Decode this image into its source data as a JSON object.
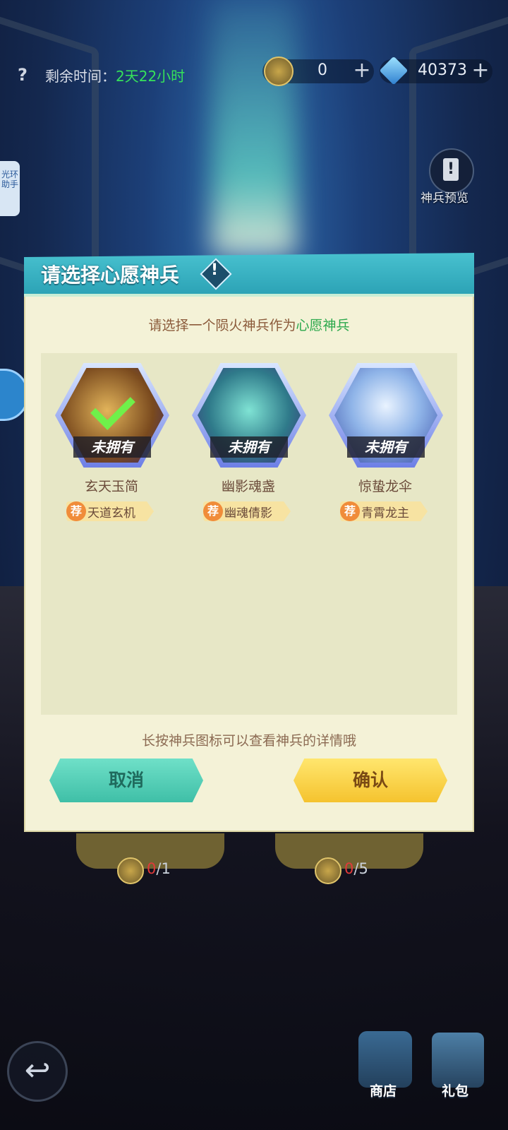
{
  "topbar": {
    "help": "?",
    "time_label": "剩余时间：",
    "time_value": "2天22小时",
    "currency_a": "0",
    "currency_b": "40373",
    "plus": "+"
  },
  "side": {
    "tab_label": "光环助手"
  },
  "preview": {
    "label": "神兵预览",
    "icon_glyph": "!"
  },
  "dialog": {
    "title": "请选择心愿神兵",
    "info_glyph": "!",
    "subtitle_pre": "请选择一个陨火神兵作为",
    "subtitle_hl": "心愿神兵",
    "items": [
      {
        "name": "玄天玉简",
        "status": "未拥有",
        "tag_icon": "荐",
        "tag": "天道玄机",
        "selected": true,
        "color": "#c98a3a"
      },
      {
        "name": "幽影魂盏",
        "status": "未拥有",
        "tag_icon": "荐",
        "tag": "幽魂倩影",
        "selected": false,
        "color": "#3aa7a0"
      },
      {
        "name": "惊蛰龙伞",
        "status": "未拥有",
        "tag_icon": "荐",
        "tag": "青霄龙主",
        "selected": false,
        "color": "#8fb4e8"
      }
    ],
    "hint": "长按神兵图标可以查看神兵的详情哦",
    "cancel": "取消",
    "confirm": "确认"
  },
  "counts": [
    {
      "have": "0",
      "total": "/1"
    },
    {
      "have": "0",
      "total": "/5"
    }
  ],
  "bottom": {
    "back_glyph": "↩",
    "shop": "商店",
    "gift": "礼包"
  }
}
